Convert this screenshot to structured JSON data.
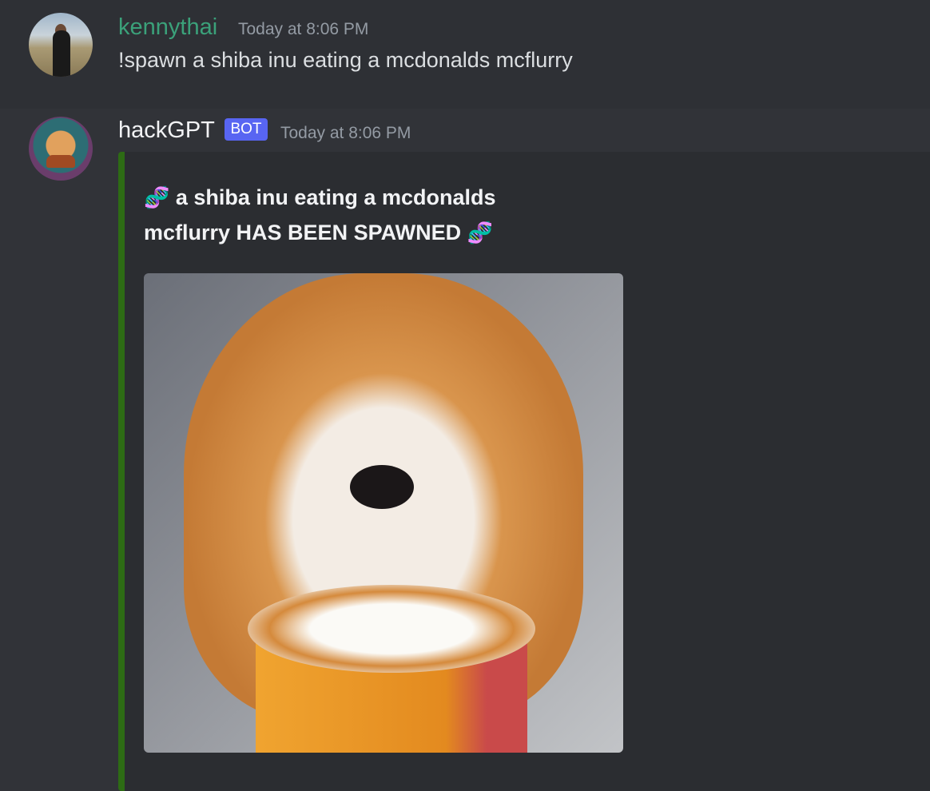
{
  "messages": [
    {
      "author": "kennythai",
      "author_color": "#3ba17a",
      "timestamp": "Today at 8:06 PM",
      "content": "!spawn a shiba inu eating a mcdonalds mcflurry"
    },
    {
      "author": "hackGPT",
      "badge": "BOT",
      "timestamp": "Today at 8:06 PM",
      "embed": {
        "dna_icon": "🧬",
        "title": "a shiba inu eating a mcdonalds mcflurry HAS BEEN SPAWNED",
        "accent_color": "#2d6b14",
        "image_alt": "shiba inu eating a mcflurry"
      }
    }
  ]
}
